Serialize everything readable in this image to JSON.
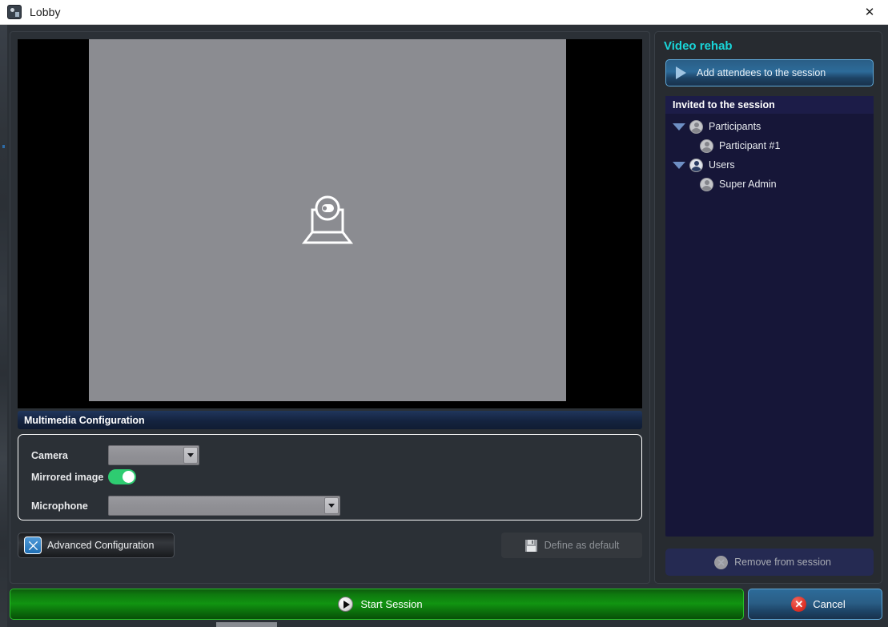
{
  "window": {
    "title": "Lobby",
    "icon": "app-icon",
    "close_label": "✕"
  },
  "video": {
    "placeholder_icon": "webcam-laptop-icon",
    "placeholder_bg": "#8b8c91",
    "letterbox_bg": "#000000"
  },
  "multimedia": {
    "header": "Multimedia Configuration",
    "camera_label": "Camera",
    "camera_value": "",
    "camera_placeholder": "",
    "mirrored_label": "Mirrored image",
    "mirrored_on": true,
    "microphone_label": "Microphone",
    "microphone_value": "",
    "microphone_placeholder": ""
  },
  "actions": {
    "advanced_label": "Advanced Configuration",
    "advanced_icon": "tools-icon",
    "define_default_label": "Define as default",
    "define_default_icon": "floppy-save-icon",
    "define_default_disabled": true
  },
  "panel": {
    "title": "Video rehab",
    "title_color": "#19d5d9",
    "add_attendees_label": "Add attendees to the session",
    "add_attendees_icon": "play-triangle-icon",
    "tree_header": "Invited to the session",
    "tree": [
      {
        "label": "Participants",
        "level": 0,
        "expanded": true,
        "icon": "user-avatar-icon"
      },
      {
        "label": "Participant #1",
        "level": 1,
        "expanded": false,
        "icon": "user-avatar-icon"
      },
      {
        "label": "Users",
        "level": 0,
        "expanded": true,
        "icon": "user-avatar-blue-icon"
      },
      {
        "label": "Super Admin",
        "level": 1,
        "expanded": false,
        "icon": "user-avatar-icon"
      }
    ],
    "remove_label": "Remove from session",
    "remove_icon": "x-circle-icon",
    "remove_disabled": true
  },
  "footer": {
    "start_label": "Start Session",
    "start_icon": "play-circle-icon",
    "start_color": "#119411",
    "cancel_label": "Cancel",
    "cancel_icon": "x-circle-red-icon",
    "cancel_color": "#2d6b99"
  }
}
